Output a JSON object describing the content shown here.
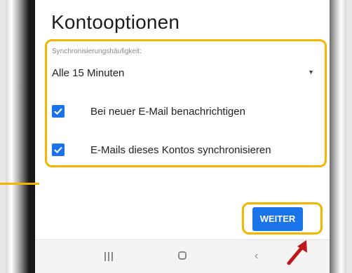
{
  "screen": {
    "title": "Kontooptionen"
  },
  "sync": {
    "label": "Synchronisierungshäufigkeit:",
    "frequency_value": "Alle 15 Minuten",
    "dropdown_icon": "dropdown-triangle-icon"
  },
  "options": [
    {
      "label": "Bei neuer E-Mail benachrichtigen",
      "checked": true
    },
    {
      "label": "E-Mails dieses Kontos synchronisieren",
      "checked": true
    }
  ],
  "actions": {
    "next_label": "WEITER"
  },
  "nav_bar": {
    "buttons": [
      "recent-apps-icon",
      "home-icon",
      "back-icon"
    ]
  },
  "colors": {
    "accent": "#1a73e8",
    "highlight": "#f4b400",
    "pointer": "#c0171b"
  }
}
